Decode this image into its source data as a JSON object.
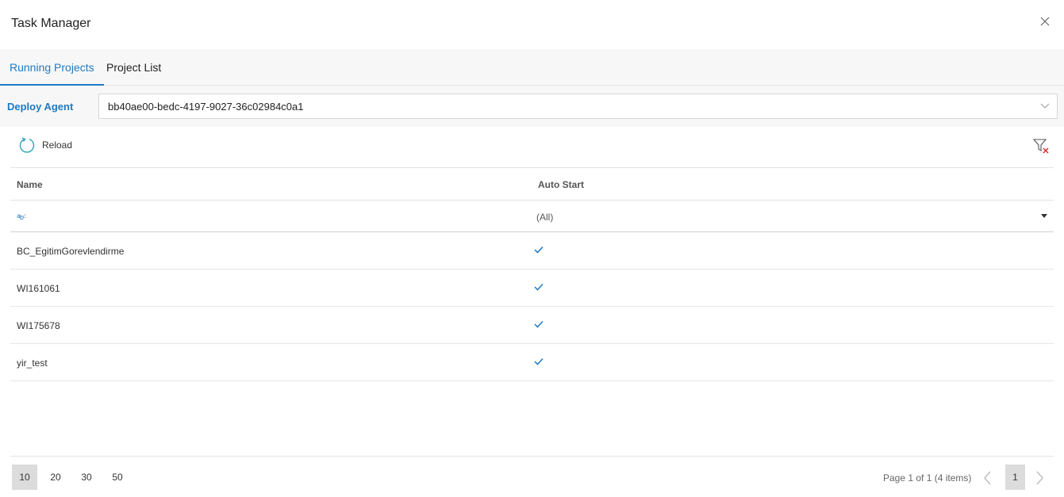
{
  "window": {
    "title": "Task Manager"
  },
  "tabs": [
    {
      "label": "Running Projects",
      "active": true
    },
    {
      "label": "Project List",
      "active": false
    }
  ],
  "agent": {
    "label": "Deploy Agent",
    "value": "bb40ae00-bedc-4197-9027-36c02984c0a1"
  },
  "toolbar": {
    "reload_label": "Reload"
  },
  "grid": {
    "columns": [
      "Name",
      "Auto Start"
    ],
    "filter": {
      "name_placeholder": "",
      "auto_start_value": "(All)"
    },
    "rows": [
      {
        "name": "BC_EgitimGorevlendirme",
        "auto_start": true
      },
      {
        "name": "WI161061",
        "auto_start": true
      },
      {
        "name": "WI175678",
        "auto_start": true
      },
      {
        "name": "yir_test",
        "auto_start": true
      }
    ]
  },
  "pager": {
    "page_sizes": [
      "10",
      "20",
      "30",
      "50"
    ],
    "active_size": "10",
    "info": "Page 1 of 1 (4 items)",
    "current_page": "1"
  },
  "colors": {
    "accent": "#1f7ac2",
    "check": "#1f7ac2",
    "filter_clear": "#e02020"
  }
}
